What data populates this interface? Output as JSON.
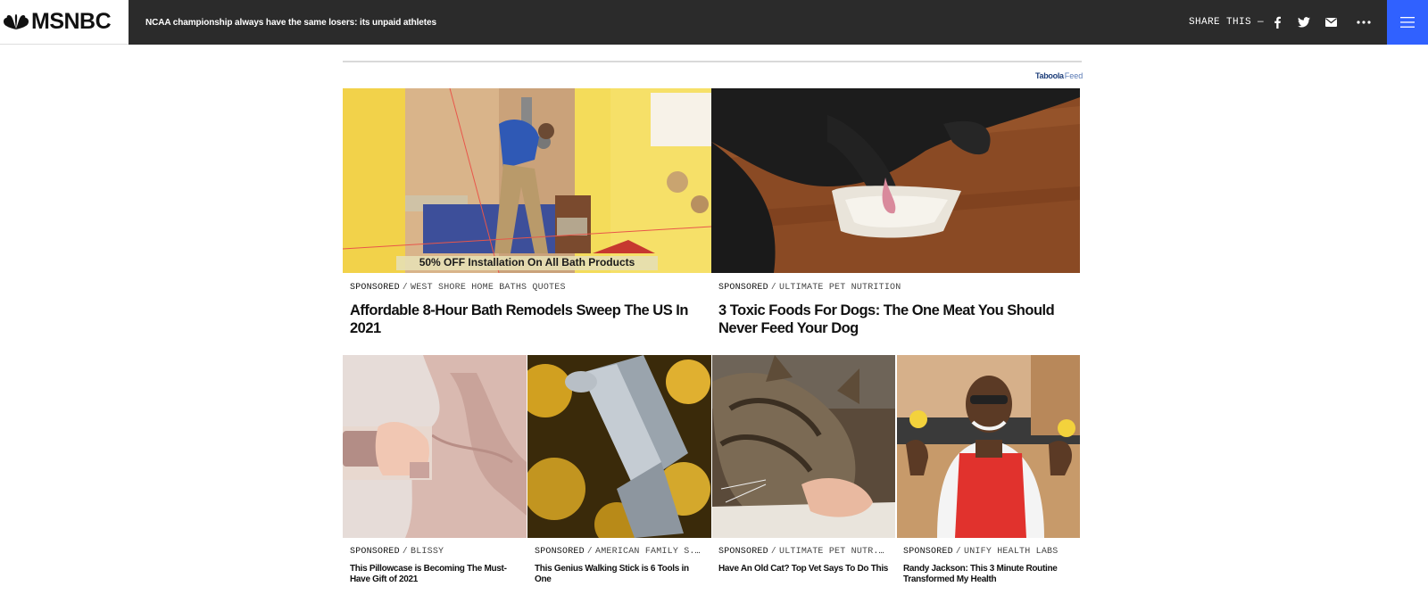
{
  "header": {
    "logo_text": "MSNBC",
    "headline": "NCAA championship always have the same losers: its unpaid athletes",
    "share_label": "SHARE THIS —",
    "icons": [
      "facebook-icon",
      "twitter-icon",
      "mail-icon",
      "more-icon",
      "hamburger-menu-icon"
    ],
    "accent_color": "#3061ff",
    "bar_color": "#2b2b2b"
  },
  "feed": {
    "provider_brand": "Taboola",
    "provider_suffix": "Feed"
  },
  "cards": [
    {
      "image_caption": "50% OFF Installation On All Bath Products",
      "sponsored": "SPONSORED",
      "brand": "WEST SHORE HOME BATHS QUOTES",
      "title": "Affordable 8-Hour Bath Remodels Sweep The US In 2021"
    },
    {
      "sponsored": "SPONSORED",
      "brand": "ULTIMATE PET NUTRITION",
      "title": "3 Toxic Foods For Dogs: The One Meat You Should Never Feed Your Dog"
    },
    {
      "sponsored": "SPONSORED",
      "brand": "BLISSY",
      "title": "This Pillowcase is Becoming The Must-Have Gift of 2021"
    },
    {
      "sponsored": "SPONSORED",
      "brand": "AMERICAN FAMILY S...",
      "title": "This Genius Walking Stick is 6 Tools in One"
    },
    {
      "sponsored": "SPONSORED",
      "brand": "ULTIMATE PET NUTR...",
      "title": "Have An Old Cat? Top Vet Says To Do This"
    },
    {
      "sponsored": "SPONSORED",
      "brand": "UNIFY HEALTH LABS",
      "title": "Randy Jackson: This 3 Minute Routine Transformed My Health"
    }
  ]
}
